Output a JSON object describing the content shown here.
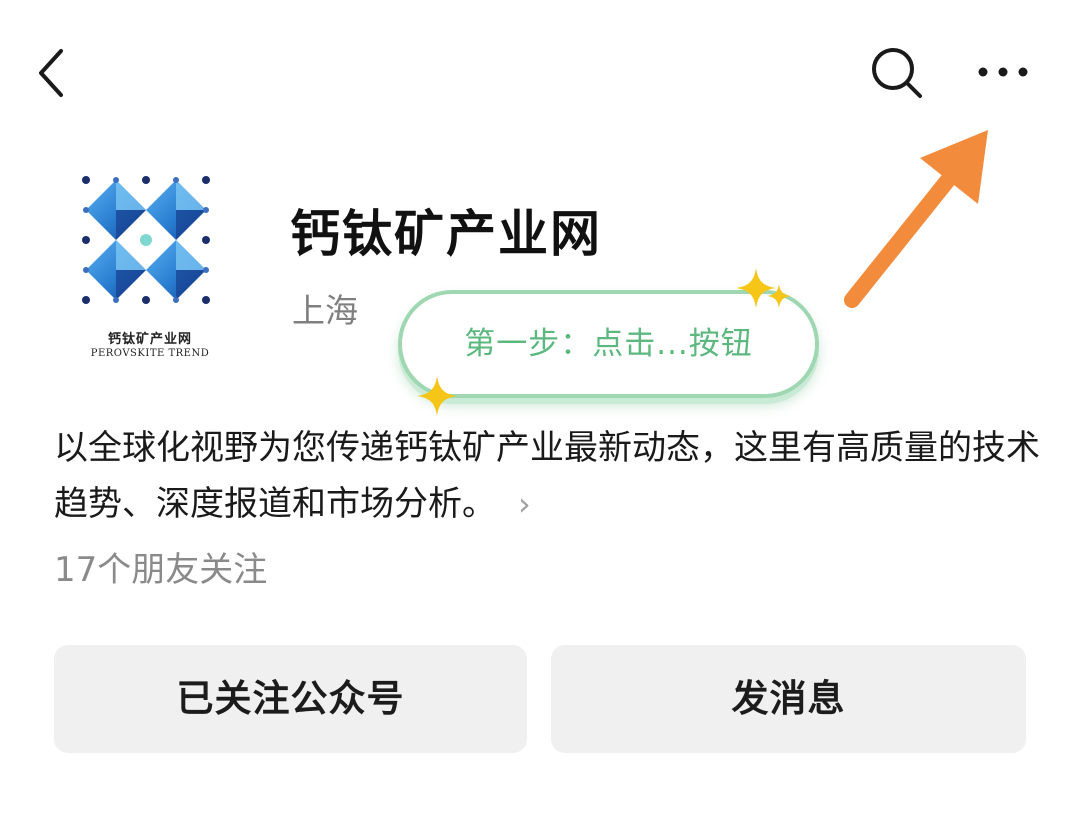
{
  "topbar": {
    "back_icon": "chevron-left-icon",
    "search_icon": "search-icon",
    "more_icon": "more-horizontal-icon"
  },
  "profile": {
    "logo_text_cn": "钙钛矿产业网",
    "logo_text_en": "PEROVSKITE TREND",
    "name": "钙钛矿产业网",
    "location": "上海",
    "description": "以全球化视野为您传递钙钛矿产业最新动态，这里有高质量的技术趋势、深度报道和市场分析。",
    "description_chevron": "›",
    "followers": "17个朋友关注"
  },
  "annotation": {
    "tip": "第一步：点击...按钮",
    "accent_color": "#5cb87f",
    "arrow_color": "#f28b3c"
  },
  "actions": {
    "follow_label": "已关注公众号",
    "message_label": "发消息"
  }
}
